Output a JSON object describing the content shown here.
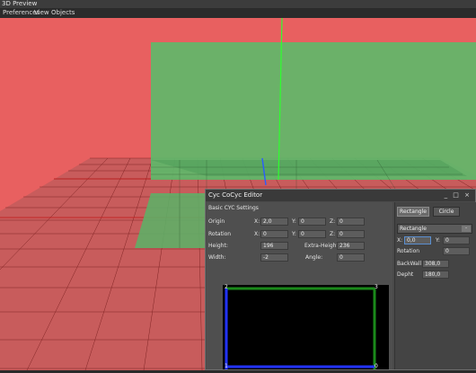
{
  "app": {
    "title": "3D Preview",
    "menu": [
      "Preferences",
      "View",
      "Objects"
    ]
  },
  "colors": {
    "background_wall": "#e86060",
    "cyc_green": "#5fb86a",
    "grid_line": "#8a2020",
    "axis_green": "#2eff2e",
    "axis_blue": "#2a5cff",
    "dialog_bg": "#4a4a4a"
  },
  "dialog": {
    "title": "Cyc CoCyc Editor",
    "controls": "_ □ ×",
    "section_title": "Basic CYC Settings",
    "origin": {
      "label": "Origin",
      "x_label": "X:",
      "x": "2,0",
      "y_label": "Y:",
      "y": "0",
      "z_label": "Z:",
      "z": "0"
    },
    "rotation": {
      "label": "Rotation",
      "x_label": "X:",
      "x": "0",
      "y_label": "Y:",
      "y": "0",
      "z_label": "Z:",
      "z": "0"
    },
    "height": {
      "label": "Height:",
      "value": "196"
    },
    "extra_height": {
      "label": "Extra-Height:",
      "value": "236"
    },
    "width": {
      "label": "Width:",
      "value": "-2"
    },
    "angle": {
      "label": "Angle:",
      "value": "0"
    },
    "preview": {
      "corner_labels": [
        "2",
        "3",
        "1",
        "0"
      ]
    },
    "shape_buttons": {
      "rectangle": "Rectangle",
      "circle": "Circle"
    },
    "shape_combo": {
      "value": "Rectangle",
      "arrow": "-"
    },
    "shape_props": {
      "x_label": "X:",
      "x": "0,0",
      "y_label": "Y:",
      "y": "0",
      "rotation_label": "Rotation",
      "rotation": "0",
      "backwall_label": "BackWall",
      "backwall": "308,0",
      "depth_label": "Depht",
      "depth": "180,0"
    }
  }
}
